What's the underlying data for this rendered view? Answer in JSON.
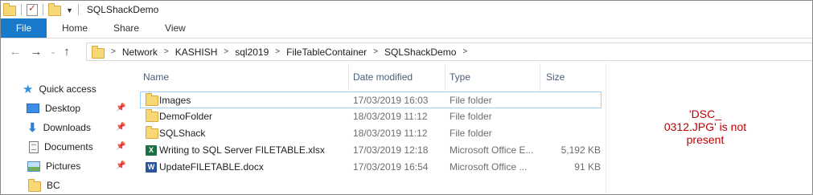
{
  "window": {
    "title": "SQLShackDemo"
  },
  "ribbon": {
    "tabs": [
      "File",
      "Home",
      "Share",
      "View"
    ],
    "accent_color": "#1979ca"
  },
  "address_bar": {
    "breadcrumbs": [
      "Network",
      "KASHISH",
      "sql2019",
      "FileTableContainer",
      "SQLShackDemo"
    ]
  },
  "sidebar": {
    "items": [
      {
        "label": "Quick access",
        "icon": "star-icon",
        "pinned": false
      },
      {
        "label": "Desktop",
        "icon": "desktop-icon",
        "pinned": true
      },
      {
        "label": "Downloads",
        "icon": "download-icon",
        "pinned": true
      },
      {
        "label": "Documents",
        "icon": "documents-icon",
        "pinned": true
      },
      {
        "label": "Pictures",
        "icon": "pictures-icon",
        "pinned": true
      },
      {
        "label": "BC",
        "icon": "folder-icon",
        "pinned": false
      }
    ]
  },
  "file_list": {
    "columns": [
      "Name",
      "Date modified",
      "Type",
      "Size"
    ],
    "rows": [
      {
        "name": "Images",
        "date": "17/03/2019 16:03",
        "type": "File folder",
        "size": "",
        "icon": "folder-icon",
        "selected": true
      },
      {
        "name": "DemoFolder",
        "date": "18/03/2019 11:12",
        "type": "File folder",
        "size": "",
        "icon": "folder-icon",
        "selected": false
      },
      {
        "name": "SQLShack",
        "date": "18/03/2019 11:12",
        "type": "File folder",
        "size": "",
        "icon": "folder-icon",
        "selected": false
      },
      {
        "name": "Writing to SQL Server FILETABLE.xlsx",
        "date": "17/03/2019 12:18",
        "type": "Microsoft Office E...",
        "size": "5,192 KB",
        "icon": "excel-icon",
        "selected": false
      },
      {
        "name": "UpdateFILETABLE.docx",
        "date": "17/03/2019 16:54",
        "type": "Microsoft Office ...",
        "size": "91 KB",
        "icon": "word-icon",
        "selected": false
      }
    ]
  },
  "annotation": {
    "lines": [
      "'DSC_",
      "0312.JPG' is not",
      "present"
    ],
    "color": "#c00000"
  }
}
